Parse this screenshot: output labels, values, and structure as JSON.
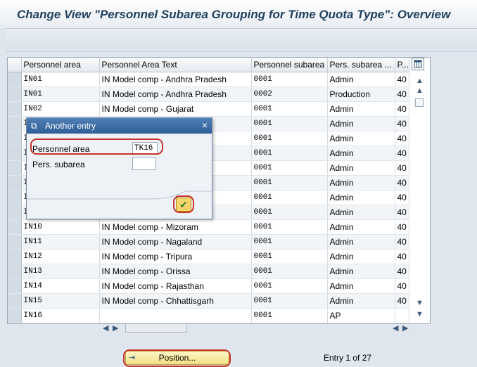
{
  "title": "Change View \"Personnel Subarea Grouping for Time Quota Type\": Overview",
  "table": {
    "columns": [
      "Personnel area",
      "Personnel Area Text",
      "Personnel subarea",
      "Pers. subarea ...",
      "P..."
    ],
    "rows": [
      [
        "IN01",
        "IN Model comp - Andhra Pradesh",
        "0001",
        "Admin",
        "40"
      ],
      [
        "IN01",
        "IN Model comp - Andhra Pradesh",
        "0002",
        "Production",
        "40"
      ],
      [
        "IN02",
        "IN Model comp - Gujarat",
        "0001",
        "Admin",
        "40"
      ],
      [
        "IN03",
        "",
        "0001",
        "Admin",
        "40"
      ],
      [
        "IN04",
        "",
        "0001",
        "Admin",
        "40"
      ],
      [
        "IN05",
        "esh",
        "0001",
        "Admin",
        "40"
      ],
      [
        "IN06",
        "",
        "0001",
        "Admin",
        "40"
      ],
      [
        "IN07",
        "",
        "0001",
        "Admin",
        "40"
      ],
      [
        "IN08",
        "",
        "0001",
        "Admin",
        "40"
      ],
      [
        "IN09",
        "",
        "0001",
        "Admin",
        "40"
      ],
      [
        "IN10",
        "IN Model comp - Mizoram",
        "0001",
        "Admin",
        "40"
      ],
      [
        "IN11",
        "IN Model comp - Nagaland",
        "0001",
        "Admin",
        "40"
      ],
      [
        "IN12",
        "IN Model comp - Tripura",
        "0001",
        "Admin",
        "40"
      ],
      [
        "IN13",
        "IN Model comp - Orissa",
        "0001",
        "Admin",
        "40"
      ],
      [
        "IN14",
        "IN Model comp - Rajasthan",
        "0001",
        "Admin",
        "40"
      ],
      [
        "IN15",
        "IN Model comp - Chhattisgarh",
        "0001",
        "Admin",
        "40"
      ],
      [
        "IN16",
        "",
        "0001",
        "AP",
        ""
      ]
    ]
  },
  "dialog": {
    "title": "Another entry",
    "field1_label": "Personnel area",
    "field1_value": "TK16",
    "field2_label": "Pers. subarea",
    "field2_value": ""
  },
  "footer": {
    "position_label": "Position...",
    "entry_text": "Entry 1 of 27"
  },
  "icons": {
    "column_config": "table-settings-icon",
    "dialog_window": "window-icon",
    "close": "close-icon",
    "confirm": "checkmark-icon",
    "position": "position-icon"
  },
  "colors": {
    "title_text": "#1f3f5e",
    "dialog_header": "#2f5f97",
    "highlight_border": "#c8322a",
    "confirm_button": "#f7d56b"
  }
}
